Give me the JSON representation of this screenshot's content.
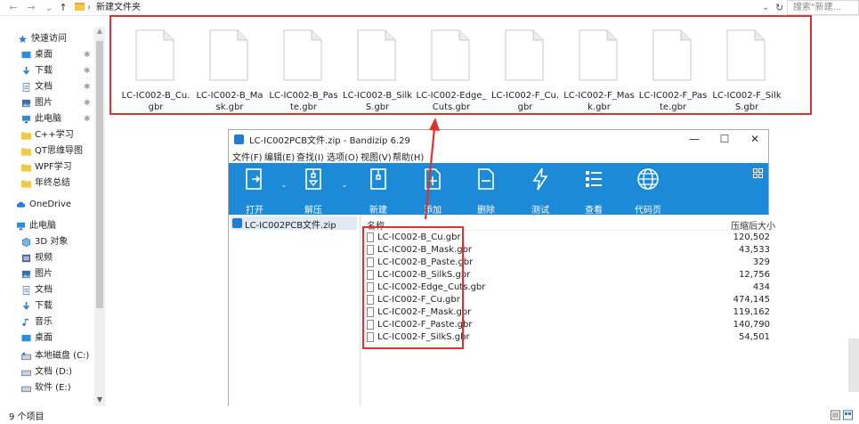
{
  "explorer": {
    "address": {
      "path_label": "新建文件夹",
      "search_placeholder": "搜索\"新建..."
    },
    "nav": {
      "items": [
        {
          "label": "快速访问",
          "icon": "star-icon"
        },
        {
          "label": "桌面",
          "icon": "desktop-icon"
        },
        {
          "label": "下载",
          "icon": "download-icon"
        },
        {
          "label": "文档",
          "icon": "document-icon"
        },
        {
          "label": "图片",
          "icon": "picture-icon"
        },
        {
          "label": "此电脑",
          "icon": "computer-icon"
        },
        {
          "label": "C++学习",
          "icon": "folder-icon"
        },
        {
          "label": "QT思维导图",
          "icon": "folder-icon"
        },
        {
          "label": "WPF学习",
          "icon": "folder-icon"
        },
        {
          "label": "年终总结",
          "icon": "folder-icon"
        },
        {
          "label": "OneDrive",
          "icon": "cloud-icon"
        },
        {
          "label": "此电脑",
          "icon": "computer-icon"
        },
        {
          "label": "3D 对象",
          "icon": "cube-icon"
        },
        {
          "label": "视频",
          "icon": "video-icon"
        },
        {
          "label": "图片",
          "icon": "picture-icon"
        },
        {
          "label": "文档",
          "icon": "document-icon"
        },
        {
          "label": "下载",
          "icon": "download-icon"
        },
        {
          "label": "音乐",
          "icon": "music-icon"
        },
        {
          "label": "桌面",
          "icon": "desktop-icon"
        },
        {
          "label": "本地磁盘 (C:)",
          "icon": "drive-icon"
        },
        {
          "label": "文档 (D:)",
          "icon": "drive-icon"
        },
        {
          "label": "软件 (E:)",
          "icon": "drive-icon"
        }
      ]
    },
    "status": "9 个项目",
    "files": [
      "LC-IC002-B_Cu.gbr",
      "LC-IC002-B_Mask.gbr",
      "LC-IC002-B_Paste.gbr",
      "LC-IC002-B_SilkS.gbr",
      "LC-IC002-Edge_Cuts.gbr",
      "LC-IC002-F_Cu.gbr",
      "LC-IC002-F_Mask.gbr",
      "LC-IC002-F_Paste.gbr",
      "LC-IC002-F_SilkS.gbr"
    ],
    "highlight_color": "#e03131"
  },
  "bandizip": {
    "title": "LC-IC002PCB文件.zip - Bandizip 6.29",
    "menu": [
      "文件(F)",
      "编辑(E)",
      "查找(I)",
      "选项(O)",
      "视图(V)",
      "帮助(H)"
    ],
    "toolbar": [
      {
        "label": "打开",
        "icon": "open-icon"
      },
      {
        "label": "解压",
        "icon": "extract-icon"
      },
      {
        "label": "新建",
        "icon": "new-archive-icon"
      },
      {
        "label": "添加",
        "icon": "add-icon"
      },
      {
        "label": "删除",
        "icon": "delete-icon"
      },
      {
        "label": "测试",
        "icon": "test-icon"
      },
      {
        "label": "查看",
        "icon": "view-icon"
      },
      {
        "label": "代码页",
        "icon": "codepage-icon"
      }
    ],
    "toolbar_color": "#1c8ad6",
    "tree_item": "LC-IC002PCB文件.zip",
    "columns": {
      "name": "名称",
      "size": "压缩后大小"
    },
    "rows": [
      {
        "name": "LC-IC002-B_Cu.gbr",
        "size": "120,502"
      },
      {
        "name": "LC-IC002-B_Mask.gbr",
        "size": "43,533"
      },
      {
        "name": "LC-IC002-B_Paste.gbr",
        "size": "329"
      },
      {
        "name": "LC-IC002-B_SilkS.gbr",
        "size": "12,756"
      },
      {
        "name": "LC-IC002-Edge_Cuts.gbr",
        "size": "434"
      },
      {
        "name": "LC-IC002-F_Cu.gbr",
        "size": "474,145"
      },
      {
        "name": "LC-IC002-F_Mask.gbr",
        "size": "119,162"
      },
      {
        "name": "LC-IC002-F_Paste.gbr",
        "size": "140,790"
      },
      {
        "name": "LC-IC002-F_SilkS.gbr",
        "size": "54,501"
      }
    ]
  }
}
